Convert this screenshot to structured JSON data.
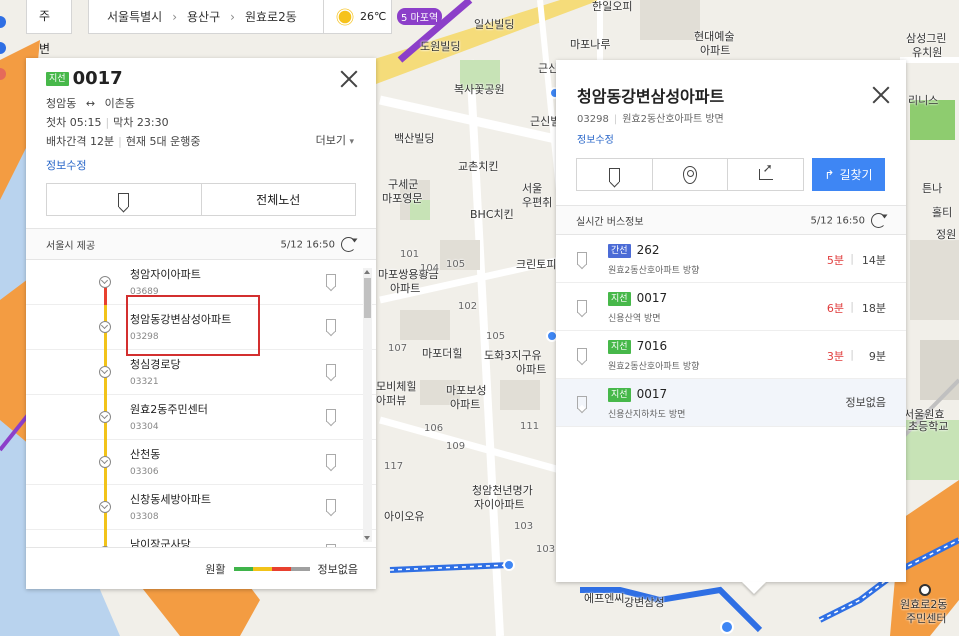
{
  "topbar": {
    "nearby_label": "주변",
    "breadcrumb": [
      "서울특별시",
      "용산구",
      "원효로2동"
    ],
    "temperature": "26℃",
    "weather_icon": "sun-icon"
  },
  "map_labels": {
    "subway_line": "5 마포역",
    "labels": [
      "일신빌딩",
      "한일오피",
      "마포나루",
      "현대예술",
      "아파트",
      "삼성그린",
      "유치원",
      "도원빌딩",
      "복사꽃공원",
      "근신",
      "근신빌",
      "백산빌딩",
      "교촌치킨",
      "구세군",
      "마포영문",
      "서울",
      "우편취",
      "BHC치킨",
      "마포쌍용황금",
      "아파트",
      "크린토피",
      "마포더힐",
      "도화3지구유",
      "아파트",
      "마포보성",
      "아파트",
      "모비체힐",
      "아퍼뷰",
      "청암천년명가",
      "자이아파트",
      "아이오유",
      "강변삼성",
      "에프엔씨",
      "원효로2동",
      "주민센터",
      "서울원효",
      "초등학교",
      "튼나",
      "홀티",
      "리니스",
      "정원",
      "101",
      "102",
      "103",
      "104",
      "105",
      "107",
      "105",
      "106",
      "111",
      "117",
      "109",
      "103"
    ]
  },
  "left_panel": {
    "badge": "지선",
    "route_number": "0017",
    "from": "청암동",
    "to": "이촌동",
    "first_bus": "첫차 05:15",
    "last_bus": "막차 23:30",
    "interval": "배차간격 12분",
    "running": "현재 5대 운행중",
    "more_label": "더보기",
    "edit_label": "정보수정",
    "full_route_label": "전체노선",
    "provider": "서울시 제공",
    "updated": "5/12 16:50",
    "stops": [
      {
        "name": "청암자이아파트",
        "id": "03689"
      },
      {
        "name": "청암동강변삼성아파트",
        "id": "03298"
      },
      {
        "name": "청심경로당",
        "id": "03321"
      },
      {
        "name": "원효2동주민센터",
        "id": "03304"
      },
      {
        "name": "산천동",
        "id": "03306"
      },
      {
        "name": "신창동세방아파트",
        "id": "03308"
      },
      {
        "name": "남이장군사당",
        "id": ""
      }
    ],
    "legend_smooth": "원활",
    "legend_noinfo": "정보없음",
    "legend_colors": [
      "#3fb44a",
      "#f2c319",
      "#e8402f",
      "#a0a0a0"
    ]
  },
  "right_panel": {
    "title": "청암동강변삼성아파트",
    "stop_id": "03298",
    "direction": "원효2동산호아파트 방면",
    "edit_label": "정보수정",
    "route_label": "길찾기",
    "realtime_label": "실시간 버스정보",
    "updated": "5/12 16:50",
    "arrivals": [
      {
        "badge": "간선",
        "route": "262",
        "dir": "원효2동산호아파트 방향",
        "t1": "5분",
        "t2": "14분",
        "noinfo": ""
      },
      {
        "badge": "지선",
        "route": "0017",
        "dir": "신용산역 방면",
        "t1": "6분",
        "t2": "18분",
        "noinfo": ""
      },
      {
        "badge": "지선",
        "route": "7016",
        "dir": "원효2동산호아파트 방향",
        "t1": "3분",
        "t2": "9분",
        "noinfo": ""
      },
      {
        "badge": "지선",
        "route": "0017",
        "dir": "신용산지하차도 방면",
        "t1": "",
        "t2": "",
        "noinfo": "정보없음"
      }
    ]
  },
  "colors": {
    "accent_blue": "#3e86f4",
    "badge_green": "#47b84a",
    "badge_blue": "#4b6bd6",
    "highlight_red": "#d32f2f",
    "arrival_red": "#e03c3c"
  }
}
